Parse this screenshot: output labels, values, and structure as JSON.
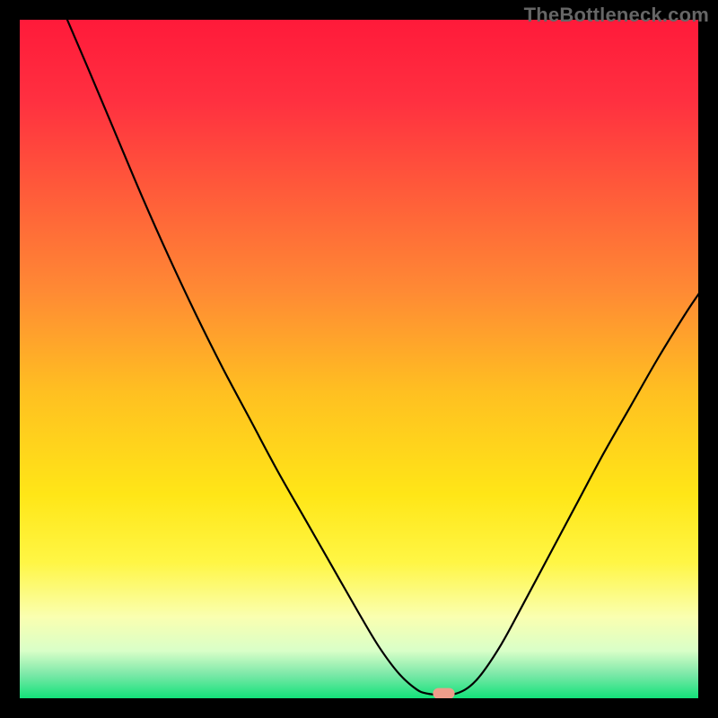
{
  "watermark": {
    "text": "TheBottleneck.com"
  },
  "chart_data": {
    "type": "line",
    "title": "",
    "xlabel": "",
    "ylabel": "",
    "xlim": [
      0,
      100
    ],
    "ylim": [
      0,
      100
    ],
    "grid": false,
    "legend": false,
    "background_gradient": {
      "stops": [
        {
          "offset": 0.0,
          "color": "#ff1a3a"
        },
        {
          "offset": 0.12,
          "color": "#ff3040"
        },
        {
          "offset": 0.25,
          "color": "#ff5a3a"
        },
        {
          "offset": 0.4,
          "color": "#ff8a34"
        },
        {
          "offset": 0.55,
          "color": "#ffc021"
        },
        {
          "offset": 0.7,
          "color": "#ffe617"
        },
        {
          "offset": 0.8,
          "color": "#fff645"
        },
        {
          "offset": 0.88,
          "color": "#faffb0"
        },
        {
          "offset": 0.93,
          "color": "#d9ffc8"
        },
        {
          "offset": 0.965,
          "color": "#7be8a8"
        },
        {
          "offset": 1.0,
          "color": "#13e27a"
        }
      ]
    },
    "series": [
      {
        "name": "bottleneck-curve",
        "color": "#000000",
        "width": 2.2,
        "points": [
          {
            "x": 7.0,
            "y": 100.0
          },
          {
            "x": 10.0,
            "y": 93.0
          },
          {
            "x": 14.0,
            "y": 83.5
          },
          {
            "x": 18.0,
            "y": 74.0
          },
          {
            "x": 22.0,
            "y": 65.0
          },
          {
            "x": 26.0,
            "y": 56.5
          },
          {
            "x": 30.0,
            "y": 48.5
          },
          {
            "x": 34.0,
            "y": 41.0
          },
          {
            "x": 38.0,
            "y": 33.5
          },
          {
            "x": 42.0,
            "y": 26.5
          },
          {
            "x": 46.0,
            "y": 19.5
          },
          {
            "x": 50.0,
            "y": 12.5
          },
          {
            "x": 53.0,
            "y": 7.5
          },
          {
            "x": 56.0,
            "y": 3.5
          },
          {
            "x": 58.5,
            "y": 1.3
          },
          {
            "x": 60.0,
            "y": 0.7
          },
          {
            "x": 62.0,
            "y": 0.5
          },
          {
            "x": 64.0,
            "y": 0.6
          },
          {
            "x": 66.0,
            "y": 1.5
          },
          {
            "x": 68.0,
            "y": 3.5
          },
          {
            "x": 71.0,
            "y": 8.0
          },
          {
            "x": 74.0,
            "y": 13.5
          },
          {
            "x": 78.0,
            "y": 21.0
          },
          {
            "x": 82.0,
            "y": 28.5
          },
          {
            "x": 86.0,
            "y": 36.0
          },
          {
            "x": 90.0,
            "y": 43.0
          },
          {
            "x": 94.0,
            "y": 50.0
          },
          {
            "x": 98.0,
            "y": 56.5
          },
          {
            "x": 100.0,
            "y": 59.5
          }
        ]
      }
    ],
    "marker": {
      "name": "optimal-point",
      "x": 62.5,
      "y": 0.7,
      "width": 3.2,
      "height": 1.6,
      "color": "#ef9d8a",
      "shape": "rounded-rect"
    }
  }
}
